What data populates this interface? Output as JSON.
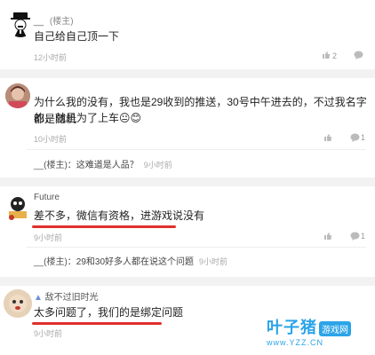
{
  "posts": [
    {
      "name": "__",
      "role": "(楼主)",
      "text": "自己给自己顶一下",
      "time": "12小时前",
      "like_count": "2"
    },
    {
      "text_line1": "为什么我的没有，我也是29收到的推送，30号中午进去的，不过我名字都是随机",
      "text_line2": "的，就是为了上车😐😊",
      "time": "10小时前",
      "reply": {
        "name": "__",
        "role": "(楼主)",
        "text": "：这难道是人品？",
        "time": "9小时前"
      }
    },
    {
      "name": "Future",
      "text": "差不多，微信有资格，进游戏说没有",
      "time": "9小时前",
      "reply": {
        "name": "__",
        "role": "(楼主)",
        "text": "：29和30好多人都在说这个问题",
        "time": "9小时前"
      }
    },
    {
      "name": "敌不过旧时光",
      "text": "太多问题了，我们的是绑定问题",
      "time": "9小时前"
    }
  ],
  "watermark": {
    "brand": "叶子猪",
    "tag": "游戏网",
    "url": "www.YZZ.CN"
  },
  "colors": {
    "underline": "#e0302d",
    "divider": "#f2f2f2",
    "watermark": "#2ba4e8"
  }
}
